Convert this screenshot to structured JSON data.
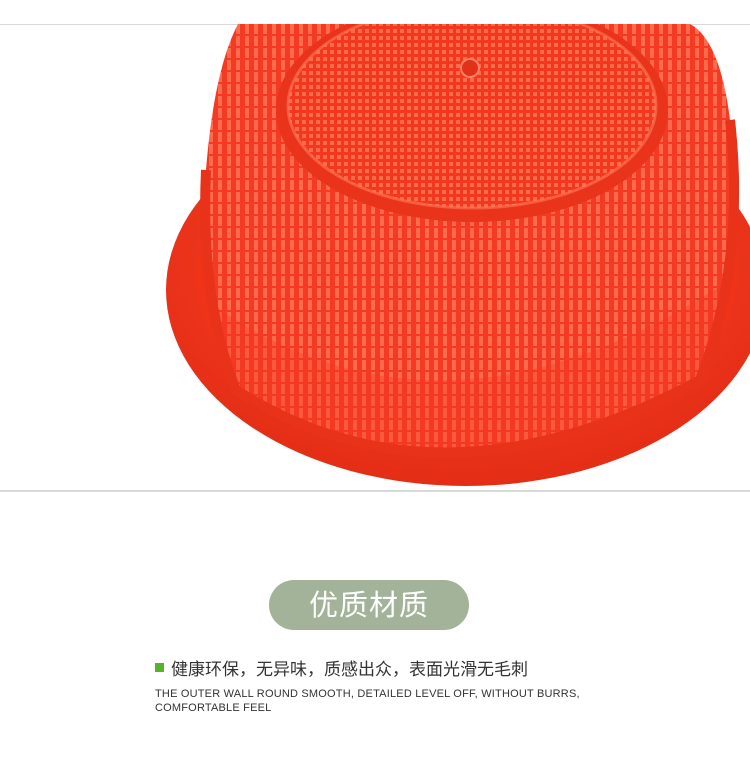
{
  "product_image": {
    "subject": "red plastic basket, underside view",
    "colors": {
      "basket": "#f43a22",
      "basket_dark": "#d92a14",
      "basket_light": "#ff6a4a",
      "frame_line": "#d9d9d9"
    }
  },
  "section_badge": {
    "label": "优质材质",
    "color": "#a3b39a"
  },
  "feature": {
    "bullet_color": "#58b22a",
    "text_cn": "健康环保，无异味，质感出众，表面光滑无毛刺",
    "text_en": "THE OUTER WALL ROUND SMOOTH, DETAILED LEVEL OFF, WITHOUT BURRS, COMFORTABLE FEEL"
  }
}
